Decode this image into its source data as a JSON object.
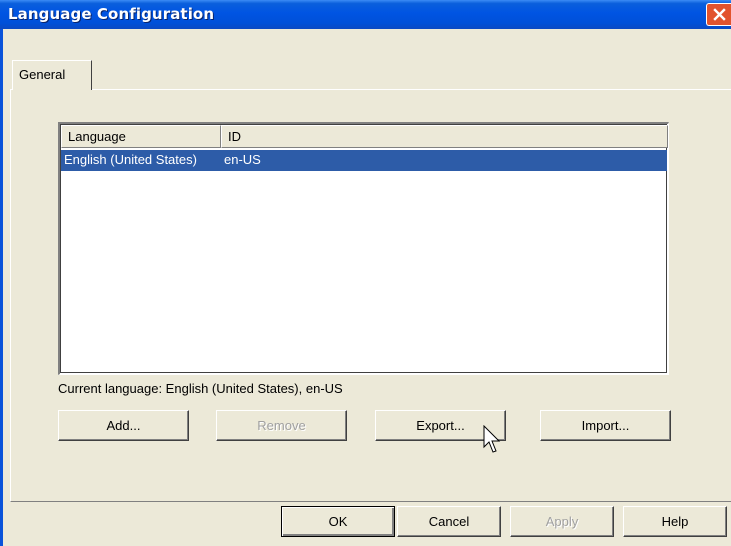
{
  "window": {
    "title": "Language Configuration"
  },
  "tabs": [
    {
      "label": "General",
      "selected": true
    }
  ],
  "list": {
    "columns": [
      {
        "label": "Language"
      },
      {
        "label": "ID"
      }
    ],
    "rows": [
      {
        "language": "English (United States)",
        "id": "en-US",
        "selected": true
      }
    ]
  },
  "current_language": "Current language: English (United States), en-US",
  "buttons": {
    "add": "Add...",
    "remove": "Remove",
    "export": "Export...",
    "import": "Import...",
    "ok": "OK",
    "cancel": "Cancel",
    "apply": "Apply",
    "help": "Help"
  },
  "icons": {
    "close": "close-icon",
    "cursor": "mouse-pointer-icon"
  },
  "colors": {
    "titlebar": "#0054E3",
    "selection": "#2D5CA8",
    "face": "#ECE9D8",
    "close": "#E2532E"
  }
}
